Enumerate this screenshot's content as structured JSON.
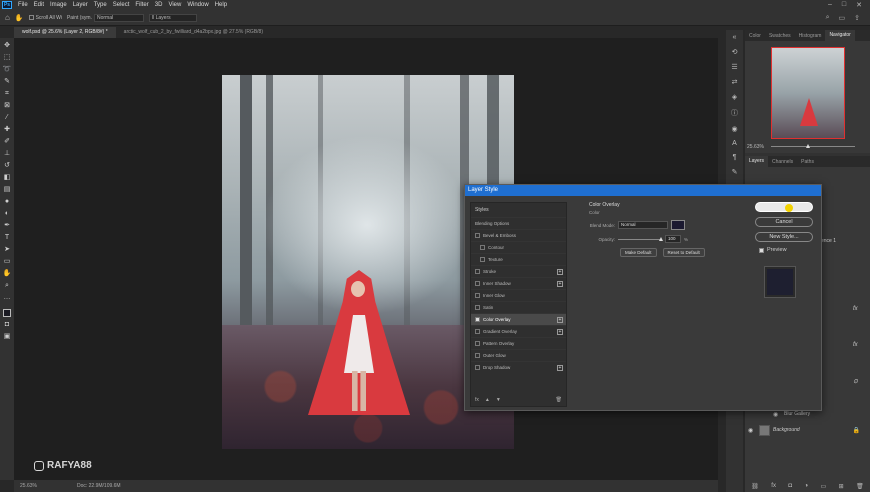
{
  "menubar": {
    "logo": "Ps",
    "items": [
      "File",
      "Edit",
      "Image",
      "Layer",
      "Type",
      "Select",
      "Filter",
      "3D",
      "View",
      "Window",
      "Help"
    ],
    "window_controls": [
      "–",
      "□",
      "✕"
    ]
  },
  "options_bar": {
    "scroll_all_windows": "Scroll All Wi",
    "paint_label": "Paint (sym.",
    "mode_value": "Normal",
    "sample_value": "ll Layers"
  },
  "tabs": [
    {
      "label": "wolf.psd @ 25.6% (Layer 2, RGB/8#) *",
      "active": true
    },
    {
      "label": "arctic_wolf_cub_2_by_fwilliard_d4a2bpx.jpg @ 27.5% (RGB/8)",
      "active": false
    }
  ],
  "watermark": {
    "text": "RAFYA88"
  },
  "status_bar": {
    "zoom": "25.63%",
    "doc": "Doc: 22.9M/109.6M"
  },
  "right_panel": {
    "top_tabs": [
      "Color",
      "Swatches",
      "Histogram",
      "Navigator"
    ],
    "navigator_zoom": "25.63%",
    "layers_tabs": [
      "Layers",
      "Channels",
      "Paths"
    ],
    "layers": [
      {
        "name": "Blur Gallery"
      },
      {
        "name": "Background"
      }
    ],
    "partial_text": "ence 1"
  },
  "dialog": {
    "title": "Layer Style",
    "styles_header": "Styles",
    "blending_options": "Blending Options",
    "items": [
      {
        "label": "Bevel & Emboss",
        "checked": false,
        "plus": false,
        "indent": false
      },
      {
        "label": "Contour",
        "checked": false,
        "plus": false,
        "indent": true
      },
      {
        "label": "Texture",
        "checked": false,
        "plus": false,
        "indent": true
      },
      {
        "label": "Stroke",
        "checked": false,
        "plus": true,
        "indent": false
      },
      {
        "label": "Inner Shadow",
        "checked": false,
        "plus": true,
        "indent": false
      },
      {
        "label": "Inner Glow",
        "checked": false,
        "plus": false,
        "indent": false
      },
      {
        "label": "Satin",
        "checked": false,
        "plus": false,
        "indent": false
      },
      {
        "label": "Color Overlay",
        "checked": true,
        "plus": true,
        "indent": false,
        "selected": true
      },
      {
        "label": "Gradient Overlay",
        "checked": false,
        "plus": true,
        "indent": false
      },
      {
        "label": "Pattern Overlay",
        "checked": false,
        "plus": false,
        "indent": false
      },
      {
        "label": "Outer Glow",
        "checked": false,
        "plus": false,
        "indent": false
      },
      {
        "label": "Drop Shadow",
        "checked": false,
        "plus": true,
        "indent": false
      }
    ],
    "footer_fx": "fx",
    "section_title": "Color Overlay",
    "section_sub": "Color",
    "blend_mode_label": "Blend Mode:",
    "blend_mode_value": "Normal",
    "overlay_color": "#1b1930",
    "opacity_label": "Opacity:",
    "opacity_value": "100",
    "opacity_unit": "%",
    "make_default": "Make Default",
    "reset_default": "Reset to Default",
    "ok_label": "",
    "cancel_label": "Cancel",
    "new_style_label": "New Style...",
    "preview_label": "Preview",
    "preview_color": "#1e1f30"
  }
}
